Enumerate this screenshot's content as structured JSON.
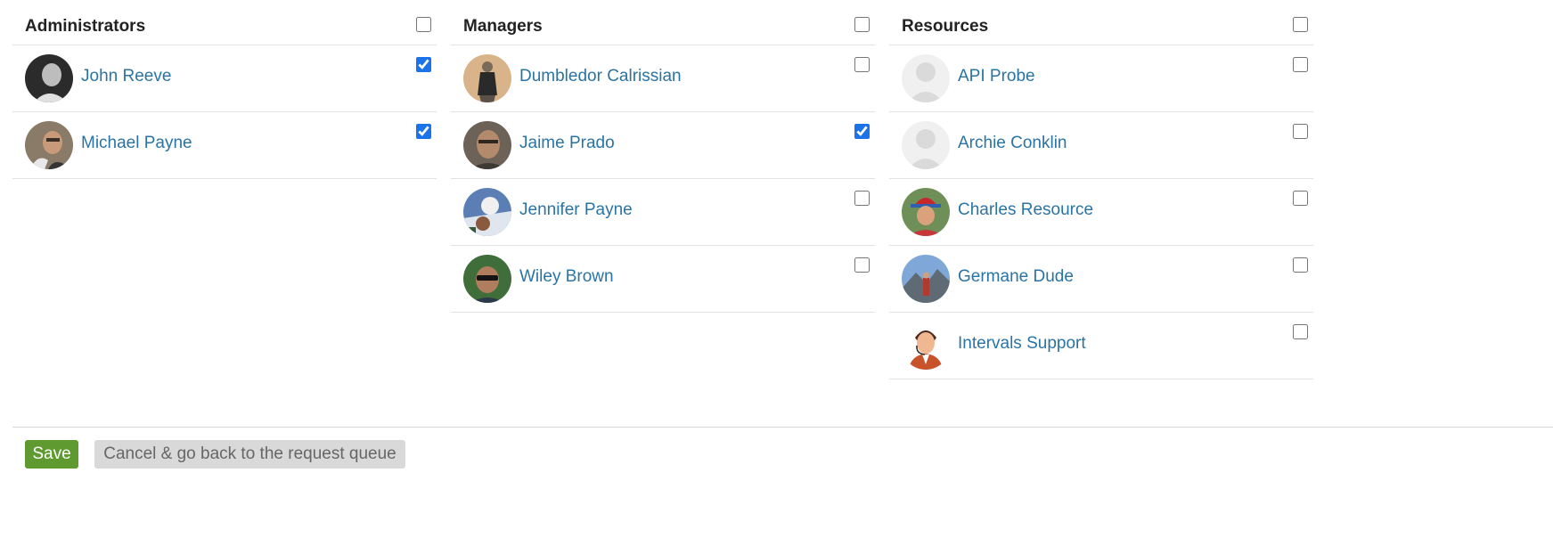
{
  "columns": {
    "administrators": {
      "title": "Administrators",
      "select_all_checked": false,
      "users": [
        {
          "name": "John Reeve",
          "checked": true
        },
        {
          "name": "Michael Payne",
          "checked": true
        }
      ]
    },
    "managers": {
      "title": "Managers",
      "select_all_checked": false,
      "users": [
        {
          "name": "Dumbledor Calrissian",
          "checked": false
        },
        {
          "name": "Jaime Prado",
          "checked": true
        },
        {
          "name": "Jennifer Payne",
          "checked": false
        },
        {
          "name": "Wiley Brown",
          "checked": false
        }
      ]
    },
    "resources": {
      "title": "Resources",
      "select_all_checked": false,
      "users": [
        {
          "name": "API Probe",
          "checked": false
        },
        {
          "name": "Archie Conklin",
          "checked": false
        },
        {
          "name": "Charles Resource",
          "checked": false
        },
        {
          "name": "Germane Dude",
          "checked": false
        },
        {
          "name": "Intervals Support",
          "checked": false
        }
      ]
    }
  },
  "actions": {
    "save_label": "Save",
    "cancel_label": "Cancel & go back to the request queue"
  },
  "colors": {
    "link": "#2a74a3",
    "save_button": "#5e9a2f",
    "cancel_button": "#d9d9d9",
    "checkbox_accent": "#1a73e8"
  }
}
